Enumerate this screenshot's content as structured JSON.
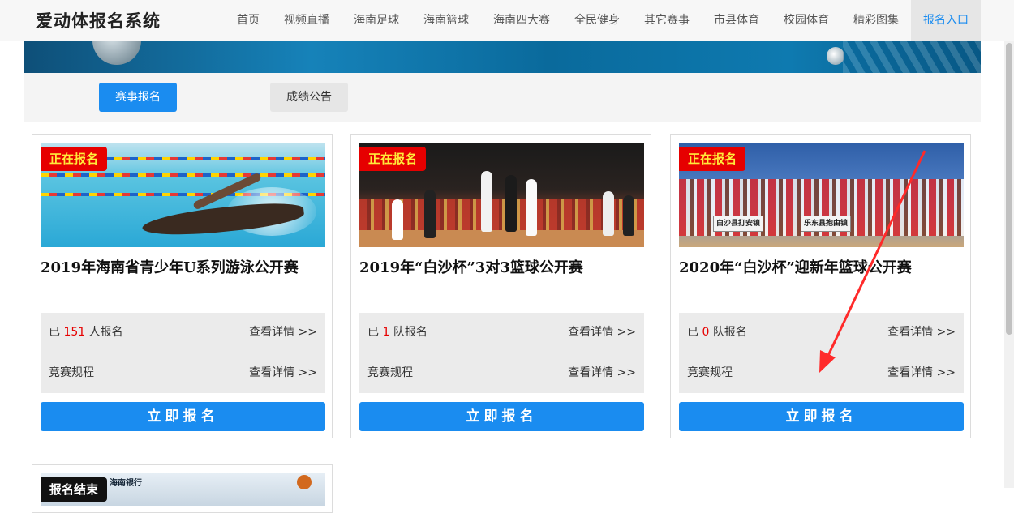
{
  "app": {
    "title": "爱动体报名系统"
  },
  "nav": {
    "items": [
      {
        "label": "首页"
      },
      {
        "label": "视频直播"
      },
      {
        "label": "海南足球"
      },
      {
        "label": "海南篮球"
      },
      {
        "label": "海南四大赛"
      },
      {
        "label": "全民健身"
      },
      {
        "label": "其它赛事"
      },
      {
        "label": "市县体育"
      },
      {
        "label": "校园体育"
      },
      {
        "label": "精彩图集"
      },
      {
        "label": "报名入口",
        "active": true
      }
    ]
  },
  "tabs": {
    "signup": "赛事报名",
    "results": "成绩公告"
  },
  "cards": [
    {
      "status": "正在报名",
      "title": "2019年海南省青少年U系列游泳公开赛",
      "count_prefix": "已",
      "count": "151",
      "count_suffix": "人报名",
      "rules": "竞赛规程",
      "detail": "查看详情 >>",
      "button": "立即报名"
    },
    {
      "status": "正在报名",
      "title": "2019年“白沙杯”3对3篮球公开赛",
      "count_prefix": "已",
      "count": "1",
      "count_suffix": "队报名",
      "rules": "竞赛规程",
      "detail": "查看详情 >>",
      "button": "立即报名"
    },
    {
      "status": "正在报名",
      "title": "2020年“白沙杯”迎新年篮球公开赛",
      "count_prefix": "已",
      "count": "0",
      "count_suffix": "队报名",
      "rules": "竞赛规程",
      "detail": "查看详情 >>",
      "button": "立即报名",
      "photo_signs": [
        "白沙县打安镇",
        "乐东县抱由镇"
      ]
    },
    {
      "status": "报名结束",
      "photo_text": "海南银行"
    }
  ],
  "colors": {
    "accent": "#1a8cf0",
    "badge_red": "#e60000",
    "badge_text": "#ffeb3b",
    "count_red": "#e60000",
    "annotation_arrow": "#ff2a2a"
  }
}
